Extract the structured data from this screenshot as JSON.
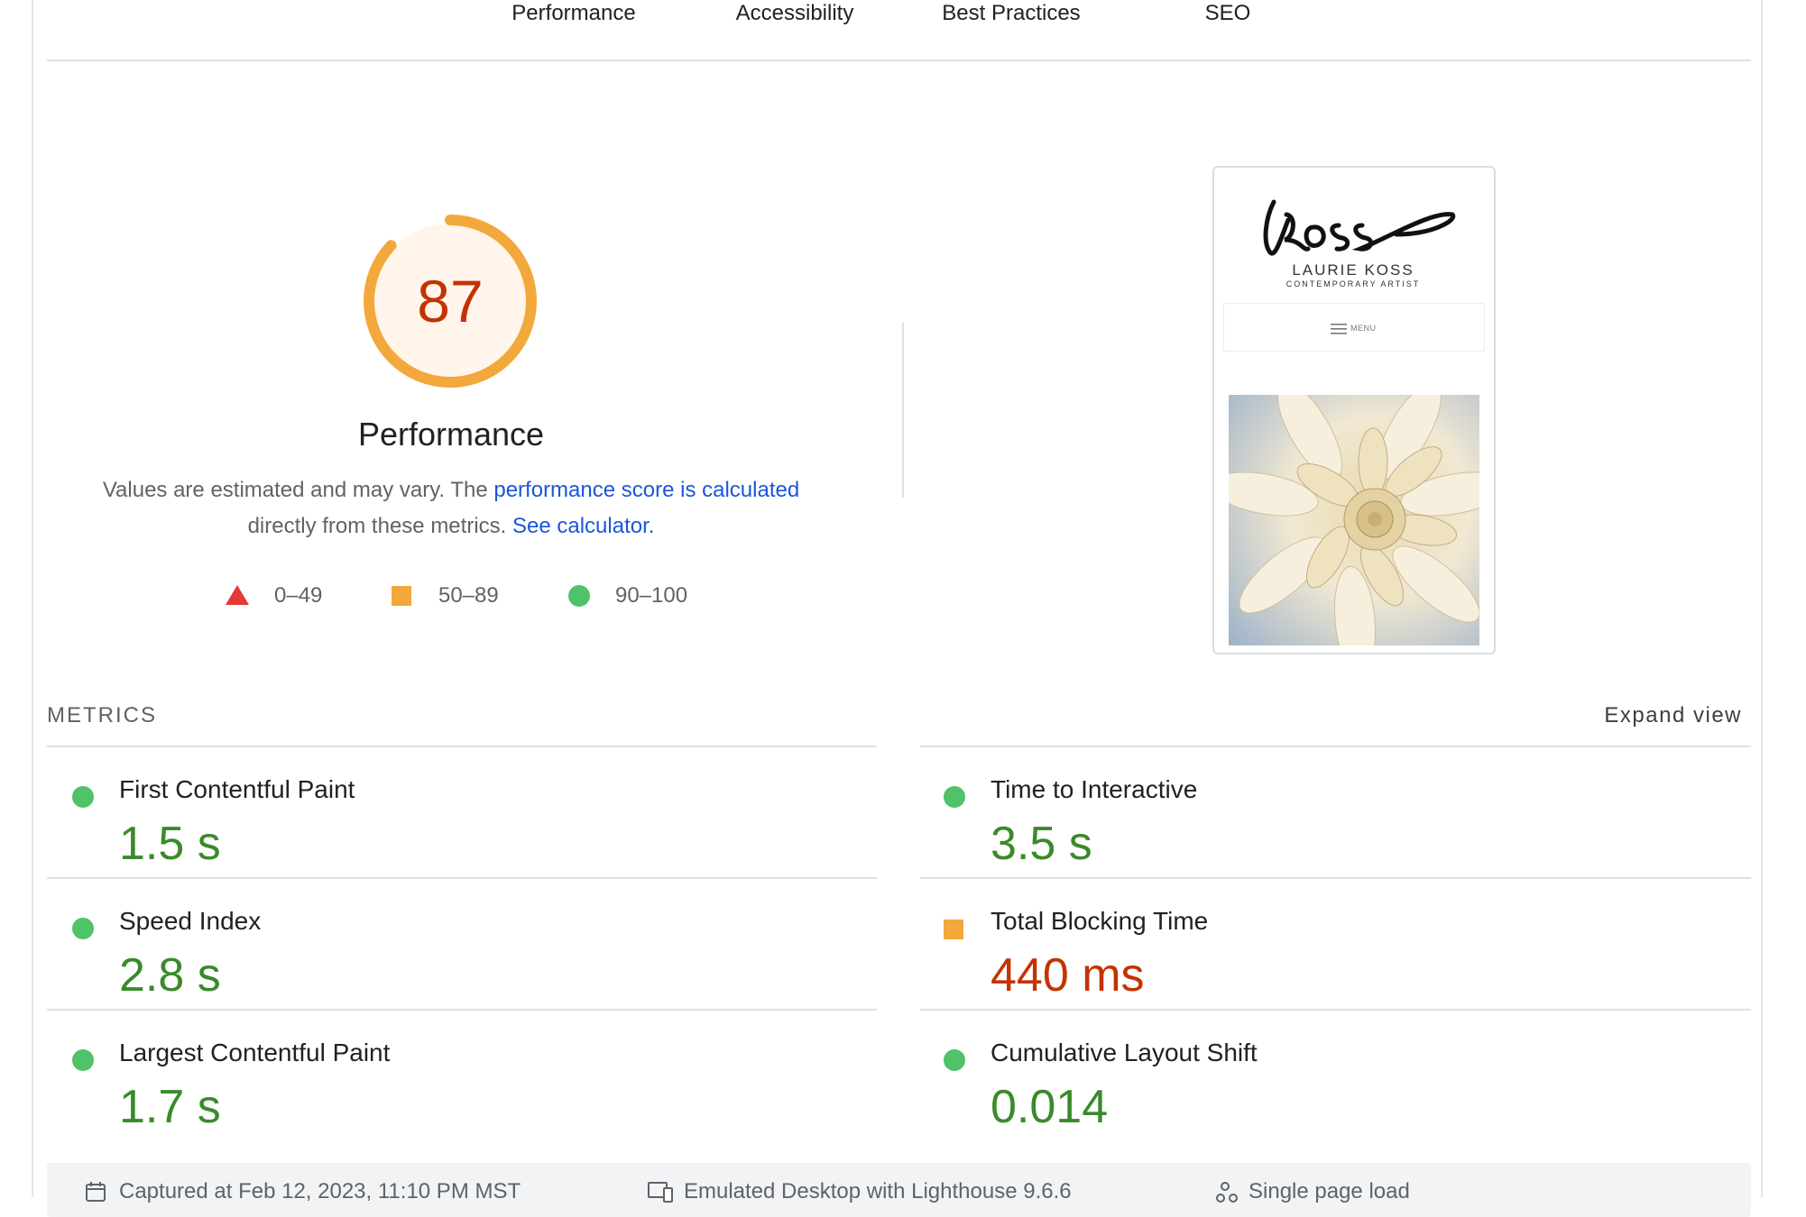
{
  "tabs": [
    "Performance",
    "Accessibility",
    "Best Practices",
    "SEO"
  ],
  "gauge": {
    "score": "87",
    "title": "Performance",
    "fraction": 0.87,
    "color": "#f2a83b",
    "bg": "#fff5ea"
  },
  "description": {
    "text1": "Values are estimated and may vary. The ",
    "link1": "performance score is calculated",
    "text2": "directly from these metrics. ",
    "link2": "See calculator."
  },
  "legend": [
    {
      "icon": "triangle-fail-icon",
      "label": "0–49",
      "color": "#e53935"
    },
    {
      "icon": "square-average-icon",
      "label": "50–89",
      "color": "#f2a83b"
    },
    {
      "icon": "circle-pass-icon",
      "label": "90–100",
      "color": "#4fc26a"
    }
  ],
  "screenshot": {
    "logo_script": "lKoss",
    "name": "LAURIE KOSS",
    "subtitle": "CONTEMPORARY ARTIST",
    "menu": "MENU"
  },
  "metrics": {
    "heading": "METRICS",
    "expand": "Expand view",
    "items": [
      {
        "label": "First Contentful Paint",
        "value": "1.5 s",
        "status": "pass"
      },
      {
        "label": "Time to Interactive",
        "value": "3.5 s",
        "status": "pass"
      },
      {
        "label": "Speed Index",
        "value": "2.8 s",
        "status": "pass"
      },
      {
        "label": "Total Blocking Time",
        "value": "440 ms",
        "status": "average"
      },
      {
        "label": "Largest Contentful Paint",
        "value": "1.7 s",
        "status": "pass"
      },
      {
        "label": "Cumulative Layout Shift",
        "value": "0.014",
        "status": "pass"
      }
    ]
  },
  "footer": {
    "captured": "Captured at Feb 12, 2023, 11:10 PM MST",
    "emulated": "Emulated Desktop with Lighthouse 9.6.6",
    "load": "Single page load"
  }
}
